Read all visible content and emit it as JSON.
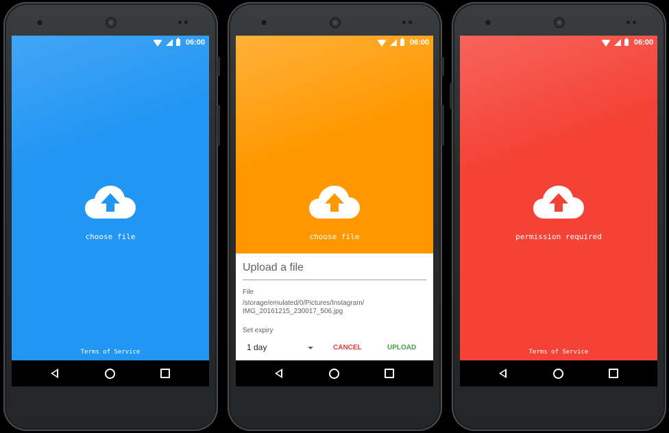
{
  "status_bar": {
    "time": "06:00"
  },
  "phones": [
    {
      "id": "blue",
      "bg": "#2196f3",
      "caption": "choose file",
      "footer": "Terms of Service"
    },
    {
      "id": "orange",
      "bg": "#ff9800",
      "caption": "choose file",
      "dialog": {
        "title": "Upload a file",
        "file_label": "File",
        "file_path": "/storage/emulated/0/Pictures/Instagram/\nIMG_20161215_230017_506.jpg",
        "expiry_label": "Set expiry",
        "expiry_value": "1 day",
        "cancel_label": "CANCEL",
        "upload_label": "UPLOAD"
      }
    },
    {
      "id": "red",
      "bg": "#f44336",
      "caption": "permission required",
      "footer": "Terms of Service"
    }
  ],
  "colors": {
    "accent_blue": "#2196f3",
    "accent_orange": "#ff9800",
    "accent_red": "#f44336",
    "cancel": "#e53935",
    "upload": "#43a047"
  },
  "icons": [
    "cloud-upload-icon",
    "wifi-icon",
    "signal-icon",
    "battery-icon",
    "back-icon",
    "home-icon",
    "recents-icon"
  ]
}
